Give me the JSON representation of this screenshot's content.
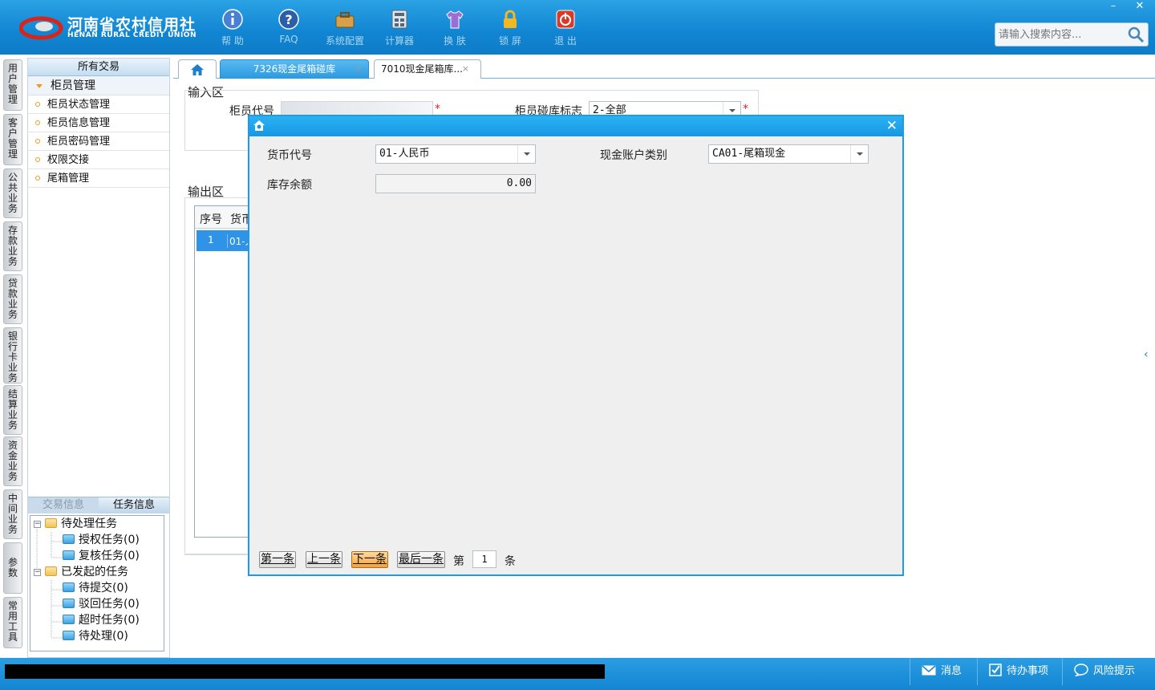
{
  "app": {
    "logo_cn": "河南省农村信用社",
    "logo_en": "HENAN RURAL CREDIT UNION"
  },
  "toolbar": [
    {
      "label": "帮 助",
      "icon": "info-icon"
    },
    {
      "label": "FAQ",
      "icon": "question-icon"
    },
    {
      "label": "系统配置",
      "icon": "toolbox-icon"
    },
    {
      "label": "计算器",
      "icon": "calculator-icon"
    },
    {
      "label": "换 肤",
      "icon": "shirt-icon"
    },
    {
      "label": "锁 屏",
      "icon": "lock-icon"
    },
    {
      "label": "退 出",
      "icon": "power-icon"
    }
  ],
  "window_controls": {
    "minimize": "–",
    "close": "✕"
  },
  "search": {
    "placeholder": "请输入搜索内容..."
  },
  "side_tabs": [
    "用\n户\n管\n理",
    "客\n户\n管\n理",
    "公\n共\n业\n务",
    "存\n款\n业\n务",
    "贷\n款\n业\n务",
    "银\n行\n卡\n业\n务",
    "结\n算\n业\n务",
    "资\n金\n业\n务",
    "中\n间\n业\n务",
    "参\n数",
    "常\n用\n工\n具"
  ],
  "left_panel": {
    "header": "所有交易",
    "group": "柜员管理",
    "items": [
      "柜员状态管理",
      "柜员信息管理",
      "柜员密码管理",
      "权限交接",
      "尾箱管理"
    ],
    "lower_tabs": [
      "交易信息",
      "任务信息"
    ],
    "tree": {
      "pending": "待处理任务",
      "auth": "授权任务(0)",
      "review": "复核任务(0)",
      "initiated": "已发起的任务",
      "to_submit": "待提交(0)",
      "rejected": "驳回任务(0)",
      "timeout": "超时任务(0)",
      "to_process": "待处理(0)"
    }
  },
  "tabs": [
    {
      "label": "7326现金尾箱碰库",
      "close": "×"
    },
    {
      "label": "7010现金尾箱库...",
      "close": "×"
    }
  ],
  "input_section": {
    "title": "输入区",
    "teller_label": "柜员代号",
    "flag_label": "柜员碰库标志",
    "flag_value": "2-全部",
    "required": "*"
  },
  "output_section": {
    "title": "输出区",
    "col_seq": "序号",
    "col_currency": "货币",
    "row_seq": "1",
    "row_currency": "01-人"
  },
  "dialog": {
    "close": "✕",
    "currency_label": "货币代号",
    "currency_value": "01-人民币",
    "account_type_label": "现金账户类别",
    "account_type_value": "CA01-尾箱现金",
    "balance_label": "库存余额",
    "balance_value": "0.00",
    "btn_first": "第一条",
    "btn_prev": "上一条",
    "btn_next": "下一条",
    "btn_last": "最后一条",
    "page_prefix": "第",
    "page_value": "1",
    "page_suffix": "条"
  },
  "status": {
    "messages": "消息",
    "todo": "待办事项",
    "risk": "风险提示"
  },
  "colors": {
    "accent": "#1597e3",
    "highlight": "#f4a23a",
    "required": "#e02020"
  }
}
